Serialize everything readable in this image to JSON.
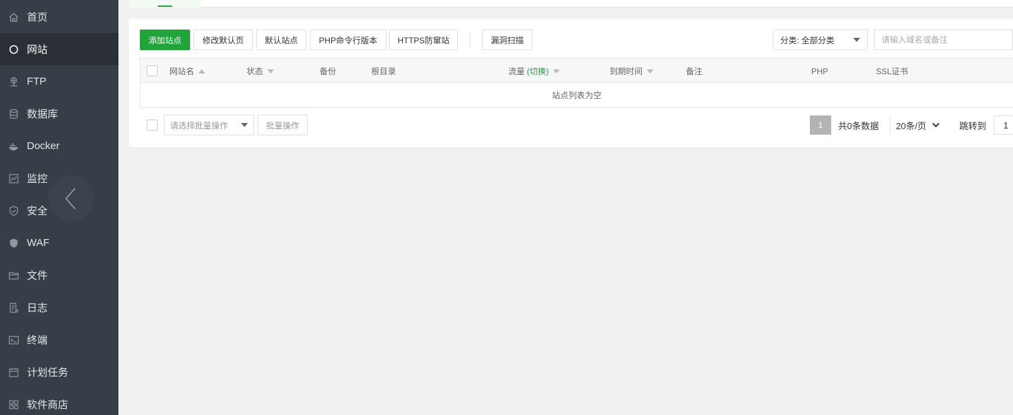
{
  "sidebar": {
    "items": [
      {
        "label": "首页",
        "icon": "home-icon"
      },
      {
        "label": "网站",
        "icon": "globe-icon",
        "active": true
      },
      {
        "label": "FTP",
        "icon": "ftp-icon"
      },
      {
        "label": "数据库",
        "icon": "database-icon"
      },
      {
        "label": "Docker",
        "icon": "docker-icon"
      },
      {
        "label": "监控",
        "icon": "monitor-icon"
      },
      {
        "label": "安全",
        "icon": "shield-icon"
      },
      {
        "label": "WAF",
        "icon": "waf-icon"
      },
      {
        "label": "文件",
        "icon": "folder-icon"
      },
      {
        "label": "日志",
        "icon": "log-icon"
      },
      {
        "label": "终端",
        "icon": "terminal-icon"
      },
      {
        "label": "计划任务",
        "icon": "calendar-icon"
      },
      {
        "label": "软件商店",
        "icon": "apps-icon"
      }
    ]
  },
  "toolbar": {
    "add_site": "添加站点",
    "edit_default_page": "修改默认页",
    "default_site": "默认站点",
    "php_cli_version": "PHP命令行版本",
    "https_anti_tamper": "HTTPS防窜站",
    "vuln_scan": "漏洞扫描",
    "category_select": "分类: 全部分类",
    "search_placeholder": "请输入域名或备注"
  },
  "table": {
    "headers": {
      "site_name": "网站名",
      "status": "状态",
      "backup": "备份",
      "root_dir": "根目录",
      "traffic": "流量",
      "traffic_toggle": "(切换)",
      "expire_time": "到期时间",
      "remark": "备注",
      "php": "PHP",
      "ssl": "SSL证书"
    },
    "empty_text": "站点列表为空"
  },
  "footer": {
    "batch_select_placeholder": "请选择批量操作",
    "batch_button": "批量操作",
    "current_page": "1",
    "total": "共0条数据",
    "page_size": "20条/页",
    "jump_label": "跳转到",
    "jump_value": "1"
  },
  "colors": {
    "brand": "#20a53a",
    "sidebar_bg": "#363f47",
    "sidebar_active": "#2a3036"
  }
}
